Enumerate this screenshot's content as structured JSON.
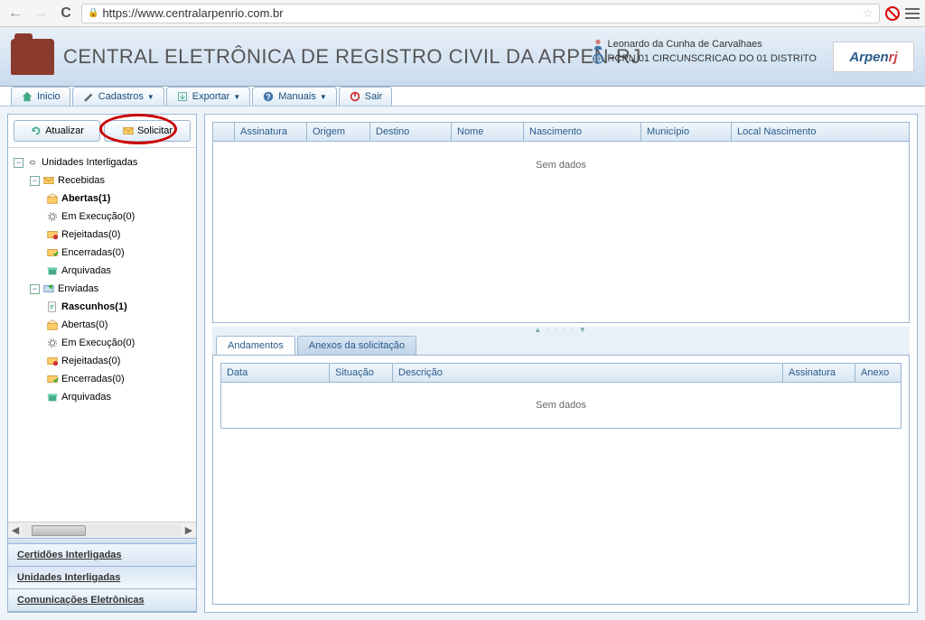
{
  "browser": {
    "url": "https://www.centralarpenrio.com.br"
  },
  "header": {
    "title": "CENTRAL ELETRÔNICA DE REGISTRO CIVIL DA ARPEN-RJ",
    "user_name": "Leonardo da Cunha de Carvalhaes",
    "user_org": "RCPN 01 CIRCUNSCRICAO DO 01 DISTRITO",
    "logo_text_a": "Arpen",
    "logo_text_b": "rj"
  },
  "menu": {
    "items": [
      "Inicio",
      "Cadastros",
      "Exportar",
      "Manuais",
      "Sair"
    ]
  },
  "sidebar": {
    "btn_atualizar": "Atualizar",
    "btn_solicitar": "Solicitar",
    "root": "Unidades Interligadas",
    "recebidas": "Recebidas",
    "recebidas_items": {
      "abertas": "Abertas(1)",
      "em_exec": "Em Execução(0)",
      "rejeitadas": "Rejeitadas(0)",
      "encerradas": "Encerradas(0)",
      "arquivadas": "Arquivadas"
    },
    "enviadas": "Enviadas",
    "enviadas_items": {
      "rascunhos": "Rascunhos(1)",
      "abertas": "Abertas(0)",
      "em_exec": "Em Execução(0)",
      "rejeitadas": "Rejeitadas(0)",
      "encerradas": "Encerradas(0)",
      "arquivadas": "Arquivadas"
    },
    "tabs": {
      "certidoes": "Certidões Interligadas",
      "unidades": "Unidades Interligadas",
      "comunicacoes": "Comunicações Eletrônicas"
    }
  },
  "grid_top": {
    "cols": {
      "check": "",
      "assinatura": "Assinatura",
      "origem": "Origem",
      "destino": "Destino",
      "nome": "Nome",
      "nascimento": "Nascimento",
      "municipio": "Município",
      "local": "Local Nascimento"
    },
    "empty": "Sem dados"
  },
  "tabs": {
    "andamentos": "Andamentos",
    "anexos": "Anexos da solicitação"
  },
  "grid_bottom": {
    "cols": {
      "data": "Data",
      "situacao": "Situação",
      "descricao": "Descrição",
      "assinatura": "Assinatura",
      "anexo": "Anexo"
    },
    "empty": "Sem dados"
  }
}
